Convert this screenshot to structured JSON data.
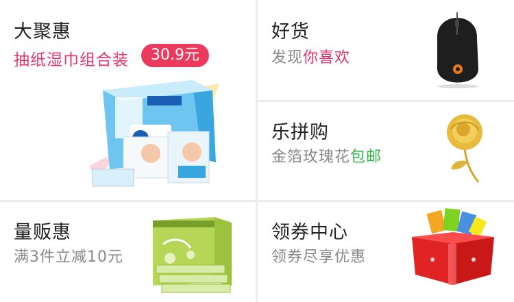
{
  "big_deal": {
    "title": "大聚惠",
    "subtitle": "抽纸湿巾组合装",
    "price": "30.9元",
    "product_image": "tissue-box-bundle-image"
  },
  "good_goods": {
    "title": "好货",
    "subtitle_plain": "发现",
    "subtitle_highlight": "你喜欢",
    "product_image": "gaming-mouse-image"
  },
  "group_buy": {
    "title": "乐拼购",
    "subtitle_plain": "金箔玫瑰花",
    "subtitle_highlight": "包邮",
    "product_image": "gold-rose-image"
  },
  "volume_deal": {
    "title": "量贩惠",
    "subtitle": "满3件立减10元",
    "product_image": "tissue-pack-image"
  },
  "coupon_center": {
    "title": "领券中心",
    "subtitle": "领券尽享优惠",
    "product_image": "red-gift-box-image"
  },
  "colors": {
    "highlight_pink": "#e8326a",
    "price_bg": "#ec3a5e",
    "highlight_green": "#36b24a"
  }
}
